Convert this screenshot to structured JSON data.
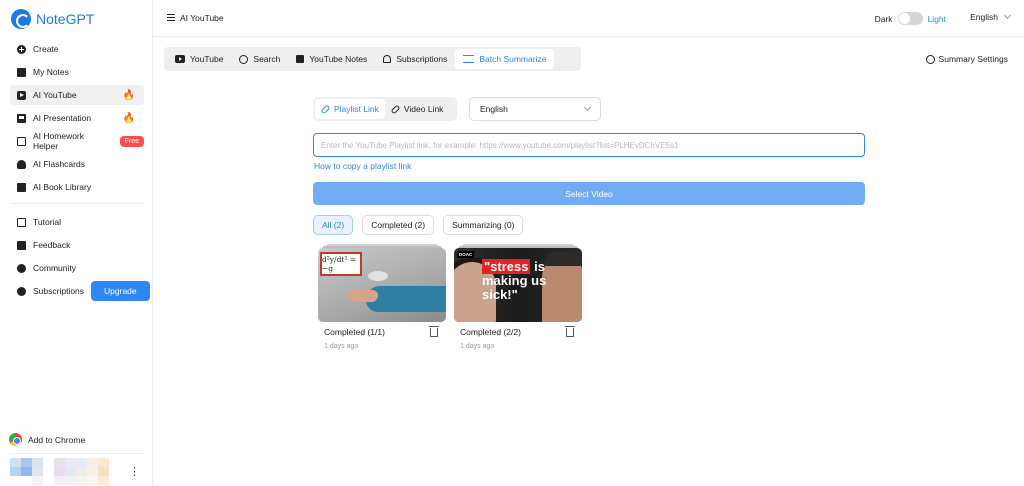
{
  "app": {
    "name": "NoteGPT"
  },
  "sidebar": {
    "items": [
      {
        "label": "Create"
      },
      {
        "label": "My Notes"
      },
      {
        "label": "AI YouTube"
      },
      {
        "label": "AI Presentation"
      },
      {
        "label": "AI Homework Helper",
        "badge": "Free"
      },
      {
        "label": "AI Flashcards"
      },
      {
        "label": "AI Book Library"
      }
    ],
    "secondary": [
      {
        "label": "Tutorial"
      },
      {
        "label": "Feedback"
      },
      {
        "label": "Community"
      },
      {
        "label": "Subscriptions",
        "button": "Upgrade"
      }
    ],
    "add_to_chrome": "Add to Chrome"
  },
  "header": {
    "title": "AI YouTube",
    "theme_dark": "Dark",
    "theme_light": "Light",
    "language": "English"
  },
  "tabs": [
    {
      "label": "YouTube"
    },
    {
      "label": "Search"
    },
    {
      "label": "YouTube Notes"
    },
    {
      "label": "Subscriptions"
    },
    {
      "label": "Batch Summarize"
    }
  ],
  "summary_settings": "Summary Settings",
  "link_type": {
    "playlist": "Playlist Link",
    "video": "Video Link"
  },
  "language_select": {
    "selected": "English"
  },
  "url_input": {
    "value": "",
    "placeholder": "Enter the YouTube Playlist link, for example: https://www.youtube.com/playlist?list=PLHEvDChVE5s1"
  },
  "howto_link": "How to copy a playlist link",
  "select_video": "Select Video",
  "filters": [
    {
      "label": "All (2)"
    },
    {
      "label": "Completed (2)"
    },
    {
      "label": "Summarizing (0)"
    }
  ],
  "cards": [
    {
      "status": "Completed (1/1)",
      "ago": "1 days ago",
      "thumb_text": "d²y/dt² = −g"
    },
    {
      "status": "Completed (2/2)",
      "ago": "1 days ago",
      "thumb_badge": "DOAC",
      "thumb_hl": "\"stress",
      "thumb_rest1": " is",
      "thumb_line2": "making us",
      "thumb_line3": "sick!\""
    }
  ],
  "colors": {
    "accent": "#2f86f6",
    "danger": "#ff4d4f"
  }
}
